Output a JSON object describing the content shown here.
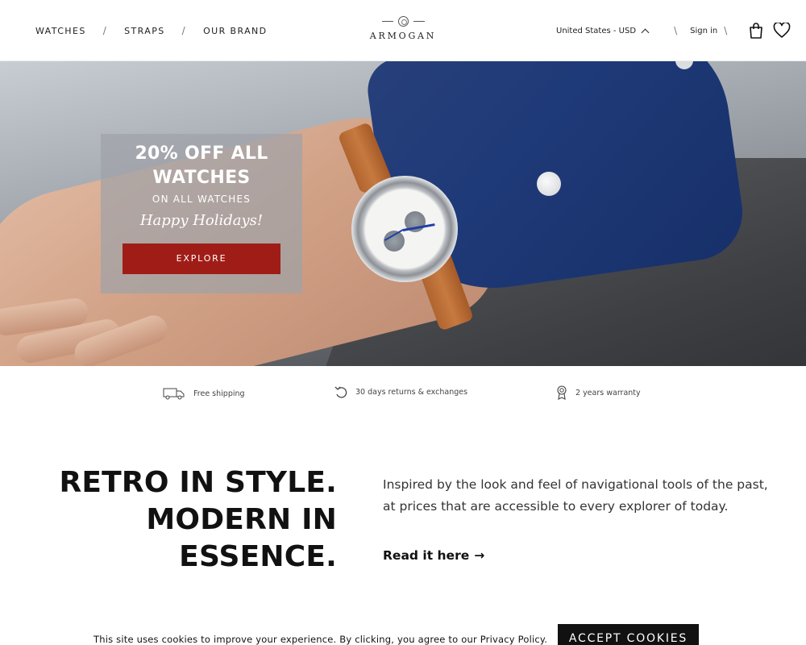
{
  "header": {
    "nav": [
      {
        "label": "WATCHES"
      },
      {
        "label": "STRAPS"
      },
      {
        "label": "OUR BRAND"
      }
    ],
    "nav_separator": "/",
    "logo_text": "ARMOGAN",
    "currency_label": "United States - USD",
    "right_separator": "\\",
    "sign_in_label": "Sign in",
    "icons": [
      "bag-icon",
      "heart-icon",
      "chevron-up-icon"
    ]
  },
  "hero": {
    "promo_title_line1": "20% OFF ALL",
    "promo_title_line2": "WATCHES",
    "promo_subtitle": "ON ALL WATCHES",
    "promo_script": "Happy Holidays!",
    "cta_label": "EXPLORE",
    "cta_color": "#a01d17"
  },
  "features": [
    {
      "icon": "truck-icon",
      "label": "Free shipping"
    },
    {
      "icon": "return-arrow-icon",
      "label": "30 days returns & exchanges"
    },
    {
      "icon": "award-ribbon-icon",
      "label": "2 years warranty"
    }
  ],
  "story": {
    "headline_line1": "RETRO IN STYLE.",
    "headline_line2": "MODERN IN",
    "headline_line3": "ESSENCE.",
    "description": "Inspired by the look and feel of navigational tools of the past, at prices that are accessible to every explorer of today.",
    "link_label": "Read it here",
    "link_arrow": "→"
  },
  "cookie_banner": {
    "text": "This site uses cookies to improve your experience. By clicking, you agree to our Privacy Policy.",
    "button_label": "ACCEPT COOKIES"
  }
}
